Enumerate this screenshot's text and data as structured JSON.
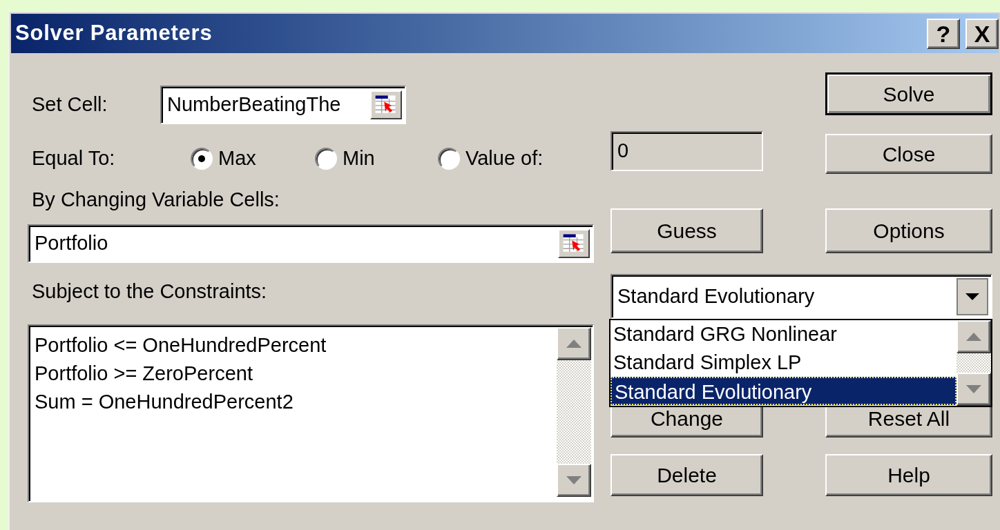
{
  "window": {
    "title": "Solver Parameters"
  },
  "title_buttons": [
    {
      "label": "?"
    },
    {
      "label": "X"
    }
  ],
  "set_cell": {
    "label": "Set Cell:",
    "value": "NumberBeatingThe"
  },
  "equal_to": {
    "label": "Equal To:",
    "options": [
      {
        "label": "Max",
        "selected": true
      },
      {
        "label": "Min",
        "selected": false
      },
      {
        "label": "Value of:",
        "selected": false
      }
    ],
    "value": "0",
    "value_disabled": true
  },
  "changing_cells": {
    "label": "By Changing Variable Cells:",
    "value": "Portfolio"
  },
  "constraints": {
    "label": "Subject to the Constraints:",
    "items": [
      "Portfolio <= OneHundredPercent",
      "Portfolio >= ZeroPercent",
      "Sum = OneHundredPercent2"
    ]
  },
  "solving_method": {
    "value": "Standard Evolutionary",
    "expanded": true,
    "options": [
      {
        "label": "Standard GRG Nonlinear",
        "selected": false
      },
      {
        "label": "Standard Simplex LP",
        "selected": false
      },
      {
        "label": "Standard Evolutionary",
        "selected": true
      }
    ]
  },
  "buttons": [
    {
      "label": "Solve",
      "default": true
    },
    {
      "label": "Close",
      "default": false
    },
    {
      "label": "Guess",
      "default": false
    },
    {
      "label": "Options",
      "default": false
    },
    {
      "label": "Change",
      "default": false
    },
    {
      "label": "Reset All",
      "default": false
    },
    {
      "label": "Delete",
      "default": false
    },
    {
      "label": "Help",
      "default": false
    }
  ]
}
